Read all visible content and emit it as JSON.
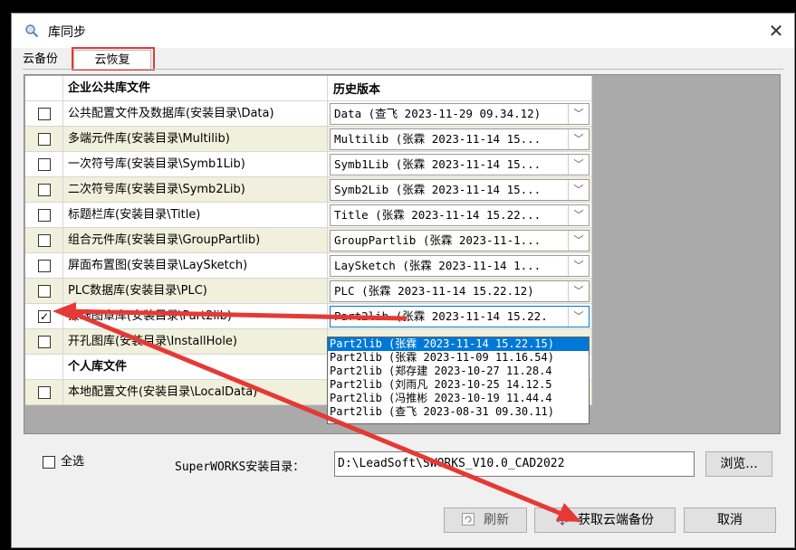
{
  "window": {
    "title": "库同步",
    "close": "✕"
  },
  "tabs": {
    "backup": "云备份",
    "restore": "云恢复"
  },
  "grid": {
    "header_name": "企业公共库文件",
    "header_version": "历史版本",
    "rows": [
      {
        "name": "公共配置文件及数据库(安装目录\\Data)",
        "version": "Data (查飞 2023-11-29 09.34.12)",
        "checked": ""
      },
      {
        "name": "多端元件库(安装目录\\Multilib)",
        "version": "Multilib (张霖 2023-11-14 15...",
        "checked": ""
      },
      {
        "name": "一次符号库(安装目录\\Symb1Lib)",
        "version": "Symb1Lib (张霖 2023-11-14 15...",
        "checked": ""
      },
      {
        "name": "二次符号库(安装目录\\Symb2Lib)",
        "version": "Symb2Lib (张霖 2023-11-14 15...",
        "checked": ""
      },
      {
        "name": "标题栏库(安装目录\\Title)",
        "version": "Title (张霖 2023-11-14 15.22...",
        "checked": ""
      },
      {
        "name": "组合元件库(安装目录\\GroupPartlib)",
        "version": "GroupPartlib (张霖 2023-11-1...",
        "checked": ""
      },
      {
        "name": "屏面布置图(安装目录\\LaySketch)",
        "version": "LaySketch (张霖 2023-11-14 1...",
        "checked": ""
      },
      {
        "name": "PLC数据库(安装目录\\PLC)",
        "version": "PLC (张霖 2023-11-14 15.22.12)",
        "checked": ""
      },
      {
        "name": "接线图章库(安装目录\\Part2lib)",
        "version": "Part2lib (张霖 2023-11-14 15.22.",
        "checked": "✓"
      },
      {
        "name": "开孔图库(安装目录\\InstallHole)",
        "version": "",
        "checked": ""
      }
    ],
    "section_personal": "个人库文件",
    "personal_rows": [
      {
        "name": "本地配置文件(安装目录\\LocalData)",
        "checked": ""
      }
    ],
    "dropdown_options": [
      "Part2lib (张霖 2023-11-14 15.22.15)",
      "Part2lib (张霖 2023-11-09 11.16.54)",
      "Part2lib (郑存建 2023-10-27 11.28.4",
      "Part2lib (刘雨凡 2023-10-25 14.12.5",
      "Part2lib (冯推彬 2023-10-19 11.44.4",
      "Part2lib (查飞 2023-08-31 09.30.11)"
    ]
  },
  "footer": {
    "select_all": "全选",
    "install_dir_label": "SuperWORKS安装目录：",
    "install_dir_value": "D:\\LeadSoft\\SWORKS_V10.0_CAD2022",
    "browse": "浏览...",
    "refresh": "刷新",
    "fetch": "获取云端备份",
    "cancel": "取消"
  },
  "colors": {
    "annotation_red": "#e53935",
    "selection_blue": "#0078d7"
  },
  "icons": {
    "title": "search-icon",
    "refresh": "refresh-icon",
    "fetch": "cloud-download-icon"
  }
}
